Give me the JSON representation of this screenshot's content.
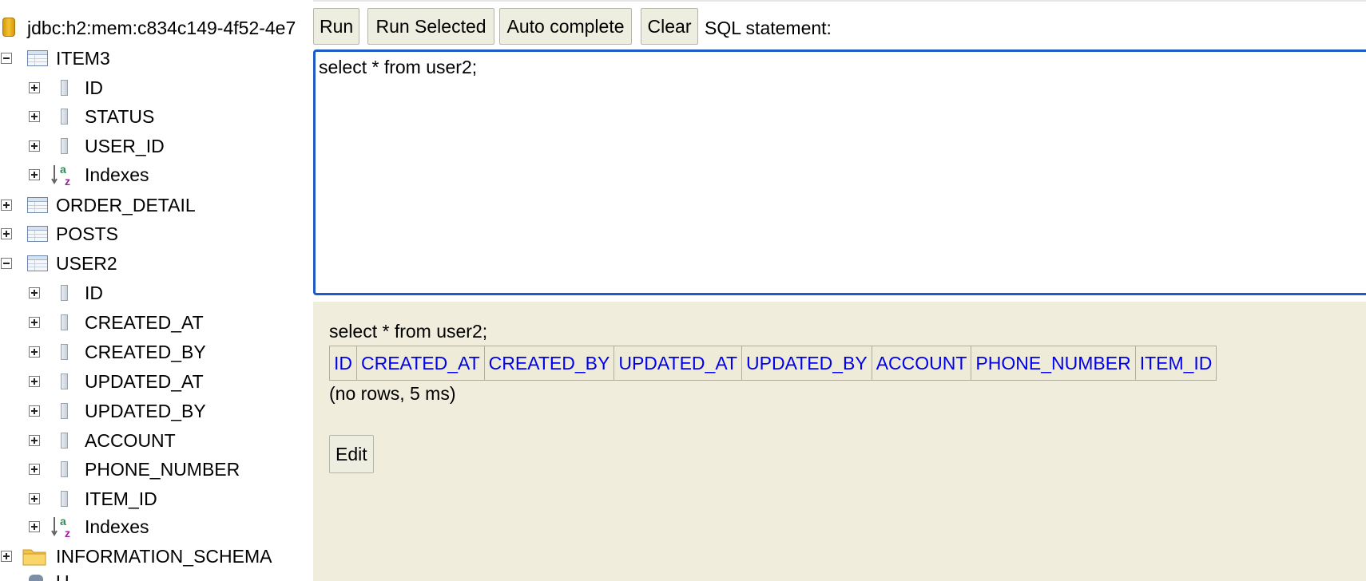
{
  "connection": {
    "url": "jdbc:h2:mem:c834c149-4f52-4e7"
  },
  "toolbar": {
    "run": "Run",
    "run_selected": "Run Selected",
    "auto_complete": "Auto complete",
    "clear": "Clear",
    "sql_statement_label": "SQL statement:"
  },
  "tree": {
    "item3": {
      "name": "ITEM3",
      "columns": [
        "ID",
        "STATUS",
        "USER_ID"
      ],
      "indexes": "Indexes"
    },
    "order_detail": {
      "name": "ORDER_DETAIL"
    },
    "posts": {
      "name": "POSTS"
    },
    "user2": {
      "name": "USER2",
      "columns": [
        "ID",
        "CREATED_AT",
        "CREATED_BY",
        "UPDATED_AT",
        "UPDATED_BY",
        "ACCOUNT",
        "PHONE_NUMBER",
        "ITEM_ID"
      ],
      "indexes": "Indexes"
    },
    "information_schema": {
      "name": "INFORMATION_SCHEMA"
    },
    "users_partial": {
      "name": "U"
    }
  },
  "editor": {
    "sql": "select * from user2;"
  },
  "result": {
    "sql": "select * from user2;",
    "columns": [
      "ID",
      "CREATED_AT",
      "CREATED_BY",
      "UPDATED_AT",
      "UPDATED_BY",
      "ACCOUNT",
      "PHONE_NUMBER",
      "ITEM_ID"
    ],
    "status": "(no rows, 5 ms)",
    "edit_label": "Edit"
  },
  "colors": {
    "editor_border": "#1f5bc6",
    "result_background": "#f0eddc",
    "link": "#0000ee",
    "button_background": "#eeeee0"
  }
}
